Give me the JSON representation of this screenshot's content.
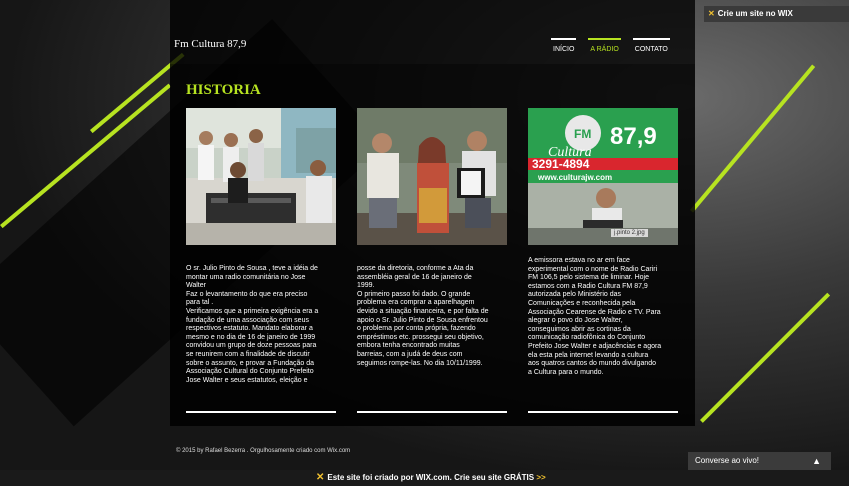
{
  "wix_top_banner": {
    "icon": "wix-x-icon",
    "label": "Crie um site no WIX"
  },
  "site": {
    "title": "Fm Cultura 87,9"
  },
  "nav": {
    "items": [
      {
        "label": "INÍCIO",
        "active": false
      },
      {
        "label": "A RÁDIO",
        "active": true
      },
      {
        "label": "CONTATO",
        "active": false
      }
    ]
  },
  "page": {
    "heading": "HISTORIA",
    "columns": [
      {
        "text": "O sr. Julio Pinto de Sousa , teve a idéia de\nmontar uma radio comunitária no Jose\nWalter\nFaz o levantamento do que era preciso\npara tal .\nVerificamos que a primeira exigência era a\nfundação de uma associação com seus\nrespectivos estatuto. Mandato elaborar a\nmesmo e no dia de 16 de janeiro de 1999\nconvidou um grupo de doze pessoas para\nse reunirem com a finalidade de discutir\nsobre o assunto, e provar a Fundação da\nAssociação Cultural do Conjunto Prefeito\nJose Walter e seus estatutos, eleição e"
      },
      {
        "text": "posse da diretoria, conforme a Ata da\nassembléia geral de 16 de janeiro de\n1999.\nO primeiro passo foi dado. O grande\nproblema era comprar a aparelhagem\ndevido a situação financeira, e por falta de\napoio o Sr. Julio Pinto de Sousa  enfrentou\no problema por conta própria, fazendo\nempréstimos etc. prossegui seu objetivo,\nembora tenha encontrado muitas\nbarreias, com a judá de deus com\nseguimos rompe-las. No dia 10/11/1999."
      },
      {
        "text": "A emissora estava no ar em face\nexperimental com o nome de Radio Cariri\nFM 106,5 pelo sistema de liminar. Hoje\nestamos com a Radio Cultura FM 87,9\nautorizada pelo Ministério das\nComunicações e reconhecida pela\nAssociação Cearense de Radio e TV. Para\nalegrar o povo do Jose Walter,\nconseguimos abrir as cortinas da\ncomunicação  radiofônica do Conjunto\nPrefeito Jose Walter e adjacências e agora\nela esta pela internet levando a cultura\naos quatros cantos do mundo divulgando\na Cultura para o mundo."
      }
    ],
    "photo3": {
      "sign_fm": "FM",
      "sign_number": "87,9",
      "sign_name": "Cultura",
      "sign_phone": "3291-4894",
      "sign_url": "www.culturajw.com",
      "caption": "j.pinto 2.jpg"
    }
  },
  "footer": {
    "copyright": "© 2015 by Rafael Bezerra . Orgulhosamente criado com Wix.com"
  },
  "chat": {
    "label": "Converse ao vivo!",
    "icon": "chevron-up-icon"
  },
  "wix_bottom_banner": {
    "text": "Este site foi criado por WIX.com. Crie seu site GRÁTIS",
    "arrow": ">>"
  },
  "colors": {
    "accent": "#b7e321",
    "panel": "#000000",
    "wix_x": "#f2c230"
  }
}
